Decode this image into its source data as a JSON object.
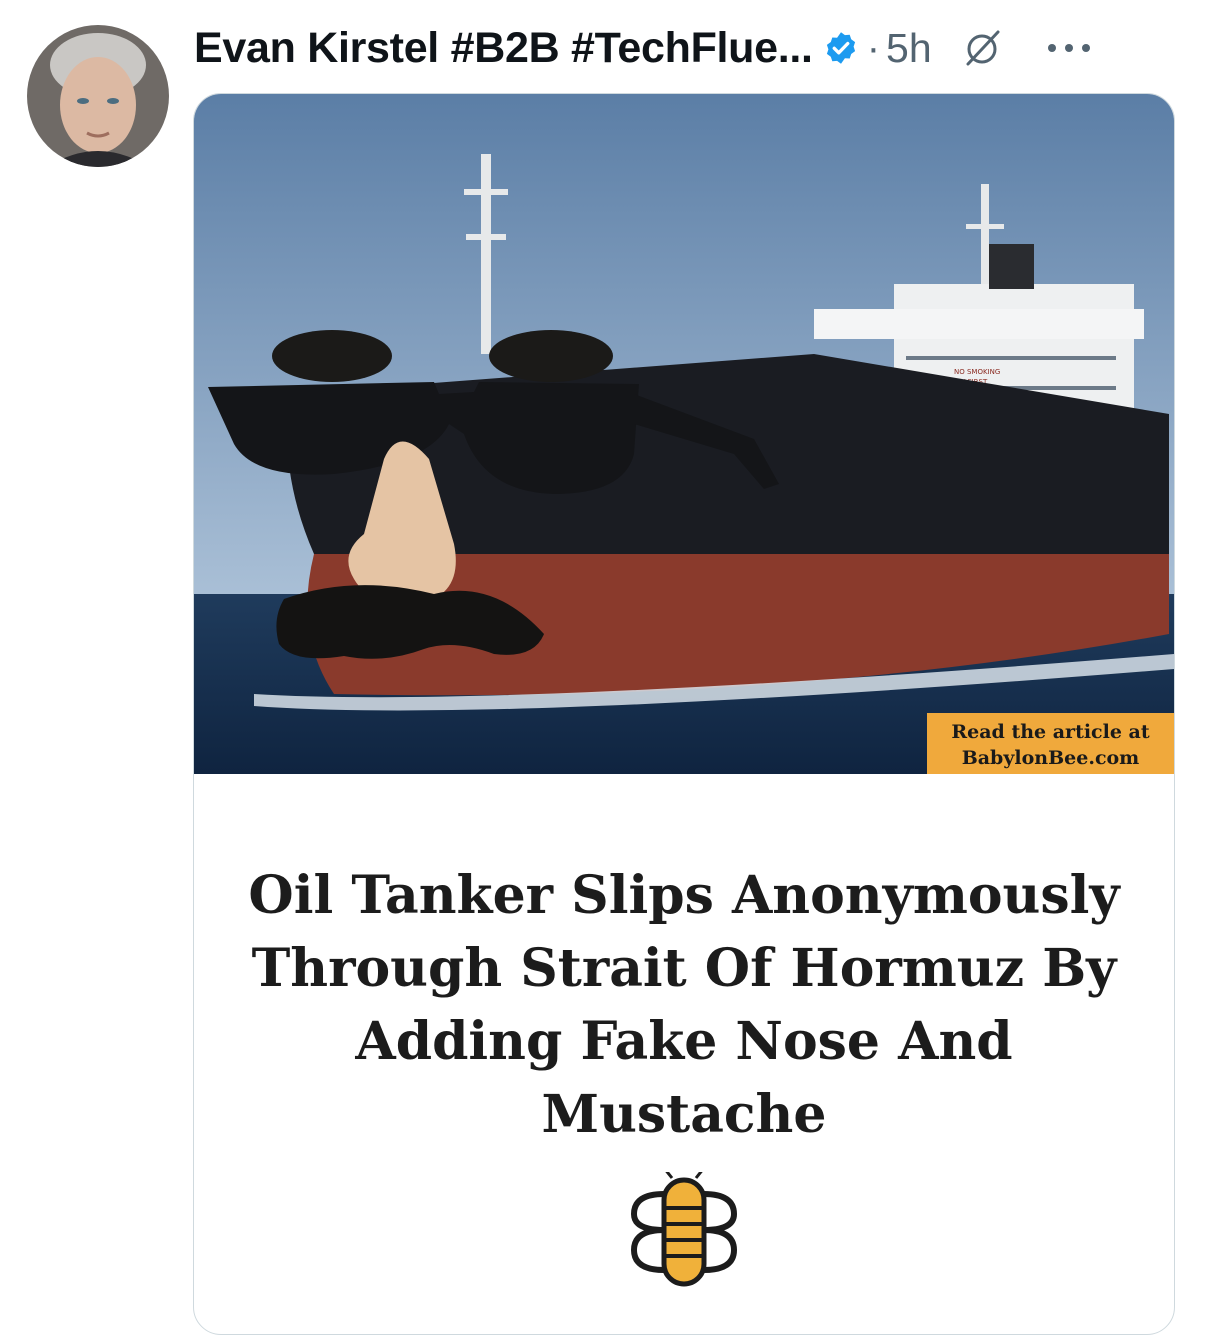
{
  "post": {
    "author_name": "Evan Kirstel #B2B #TechFlue...",
    "separator": "·",
    "timestamp": "5h",
    "icons": {
      "avatar": "author-avatar",
      "verified": "verified-badge-icon",
      "grok": "grok-icon",
      "more": "more-options-icon"
    }
  },
  "card": {
    "badge_line1": "Read the article at",
    "badge_line2": "BabylonBee.com",
    "ship_sign1": "NO SMOKING",
    "ship_sign2": "SAFETY FIRST",
    "headline_lines": [
      "Oil Tanker Slips Anonymously",
      "Through Strait Of Hormuz By",
      "Adding Fake Nose And",
      "Mustache"
    ],
    "logo": "babylon-bee-logo-icon"
  },
  "colors": {
    "verified": "#1d9bf0",
    "meta_text": "#536471",
    "badge": "#f0a93c",
    "hull_top": "#1a1c22",
    "hull_bottom": "#8a3a2c"
  }
}
